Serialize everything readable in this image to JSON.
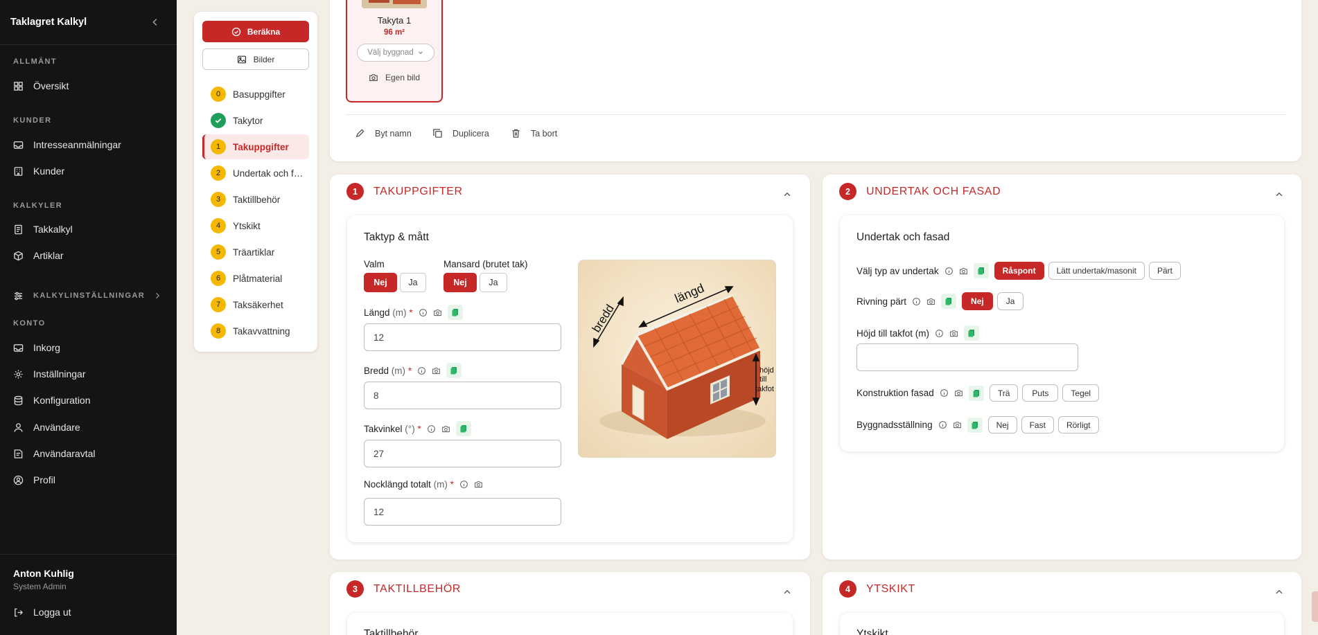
{
  "app": {
    "title": "Taklagret Kalkyl"
  },
  "sidebar": {
    "sections": [
      {
        "label": "ALLMÄNT",
        "items": [
          {
            "label": "Översikt",
            "icon": "grid-icon"
          }
        ]
      },
      {
        "label": "KUNDER",
        "items": [
          {
            "label": "Intresseanmälningar",
            "icon": "inbox-icon"
          },
          {
            "label": "Kunder",
            "icon": "building-icon"
          }
        ]
      },
      {
        "label": "KALKYLER",
        "items": [
          {
            "label": "Takkalkyl",
            "icon": "document-icon"
          },
          {
            "label": "Artiklar",
            "icon": "box-icon"
          }
        ]
      },
      {
        "label": "KALKYLINSTÄLLNINGAR",
        "items": []
      },
      {
        "label": "KONTO",
        "items": [
          {
            "label": "Inkorg",
            "icon": "inbox-icon"
          },
          {
            "label": "Inställningar",
            "icon": "gear-icon"
          },
          {
            "label": "Konfiguration",
            "icon": "database-icon"
          },
          {
            "label": "Användare",
            "icon": "user-icon"
          },
          {
            "label": "Användaravtal",
            "icon": "contract-icon"
          },
          {
            "label": "Profil",
            "icon": "profile-icon"
          }
        ]
      }
    ],
    "user": {
      "name": "Anton Kuhlig",
      "role": "System Admin"
    },
    "logout_label": "Logga ut"
  },
  "stepnav": {
    "calculate_label": "Beräkna",
    "images_label": "Bilder",
    "steps": [
      {
        "badge": "0",
        "label": "Basuppgifter",
        "state": "todo"
      },
      {
        "badge": "",
        "label": "Takytor",
        "state": "done"
      },
      {
        "badge": "1",
        "label": "Takuppgifter",
        "state": "active"
      },
      {
        "badge": "2",
        "label": "Undertak och fasad",
        "state": "todo"
      },
      {
        "badge": "3",
        "label": "Taktillbehör",
        "state": "todo"
      },
      {
        "badge": "4",
        "label": "Ytskikt",
        "state": "todo"
      },
      {
        "badge": "5",
        "label": "Träartiklar",
        "state": "todo"
      },
      {
        "badge": "6",
        "label": "Plåtmaterial",
        "state": "todo"
      },
      {
        "badge": "7",
        "label": "Taksäkerhet",
        "state": "todo"
      },
      {
        "badge": "8",
        "label": "Takavvattning",
        "state": "todo"
      }
    ]
  },
  "roof_card": {
    "name": "Takyta 1",
    "area": "96 m²",
    "select_placeholder": "Välj byggnad",
    "own_image_label": "Egen bild"
  },
  "actions": {
    "rename": "Byt namn",
    "duplicate": "Duplicera",
    "delete": "Ta bort"
  },
  "sec1": {
    "number": "1",
    "title": "TAKUPPGIFTER",
    "card_title": "Taktyp & mått",
    "valm": {
      "label": "Valm",
      "no": "Nej",
      "yes": "Ja",
      "selected": "Nej"
    },
    "mansard": {
      "label": "Mansard (brutet tak)",
      "no": "Nej",
      "yes": "Ja",
      "selected": "Nej"
    },
    "fields": [
      {
        "label": "Längd",
        "unit": "(m)",
        "value": "12"
      },
      {
        "label": "Bredd",
        "unit": "(m)",
        "value": "8"
      },
      {
        "label": "Takvinkel",
        "unit": "(°)",
        "value": "27"
      },
      {
        "label": "Nocklängd totalt",
        "unit": "(m)",
        "value": "12"
      }
    ],
    "diagram": {
      "length_label": "längd",
      "width_label": "bredd",
      "height_label_1": "höjd",
      "height_label_2": "till",
      "height_label_3": "takfot"
    }
  },
  "sec2": {
    "number": "2",
    "title": "UNDERTAK OCH FASAD",
    "card_title": "Undertak och fasad",
    "underlay": {
      "label": "Välj typ av undertak",
      "options": [
        "Råspont",
        "Lätt undertak/masonit",
        "Pärt"
      ],
      "selected": "Råspont"
    },
    "demolition": {
      "label": "Rivning pärt",
      "options": [
        "Nej",
        "Ja"
      ],
      "selected": "Nej"
    },
    "eave_height": {
      "label": "Höjd till takfot (m)",
      "value": ""
    },
    "facade": {
      "label": "Konstruktion fasad",
      "options": [
        "Trä",
        "Puts",
        "Tegel"
      ]
    },
    "scaffold": {
      "label": "Byggnadsställning",
      "options": [
        "Nej",
        "Fast",
        "Rörligt"
      ]
    }
  },
  "sec3": {
    "number": "3",
    "title": "TAKTILLBEHÖR",
    "card_title": "Taktillbehör"
  },
  "sec4": {
    "number": "4",
    "title": "YTSKIKT",
    "card_title": "Ytskikt"
  },
  "colors": {
    "accent": "#c62828",
    "sidebar_bg": "#141414",
    "badge_yellow": "#f5b800",
    "done_green": "#1e9e5a",
    "page_bg": "#f3efe7"
  }
}
